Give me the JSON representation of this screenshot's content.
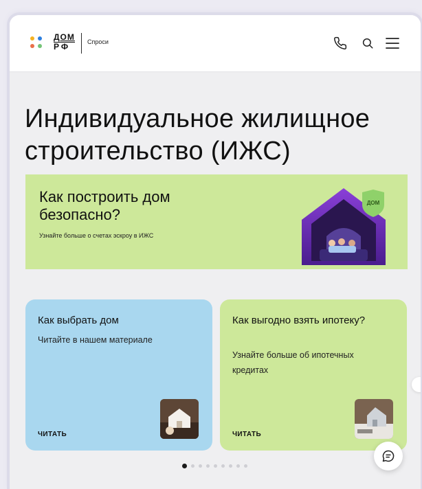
{
  "header": {
    "brand": {
      "logo_line1": "ДОМ",
      "logo_line2": "РФ",
      "subtitle": "Спроси"
    },
    "icons": [
      "phone-icon",
      "search-icon",
      "menu-icon"
    ],
    "brand_dot_colors": [
      "#f5b223",
      "#2d7fe0",
      "#e9704a",
      "#74c477"
    ]
  },
  "main": {
    "title": "Индивидуальное жилищное строительство (ИЖС)",
    "hero": {
      "title": "Как построить дом безопасно?",
      "subtitle": "Узнайте больше о счетах эскроу в ИЖС",
      "background": "#cde89a"
    },
    "cards": [
      {
        "title": "Как выбрать дом",
        "text": "Читайте в нашем материале",
        "cta": "ЧИТАТЬ",
        "background": "#a9d7ef"
      },
      {
        "title": "Как выгодно взять ипотеку?",
        "text": "Узнайте больше об ипотечных кредитах",
        "cta": "ЧИТАТЬ",
        "background": "#cde89a"
      }
    ],
    "pagination": {
      "total": 9,
      "active": 1
    }
  },
  "chat": {
    "icon": "chat-icon"
  }
}
